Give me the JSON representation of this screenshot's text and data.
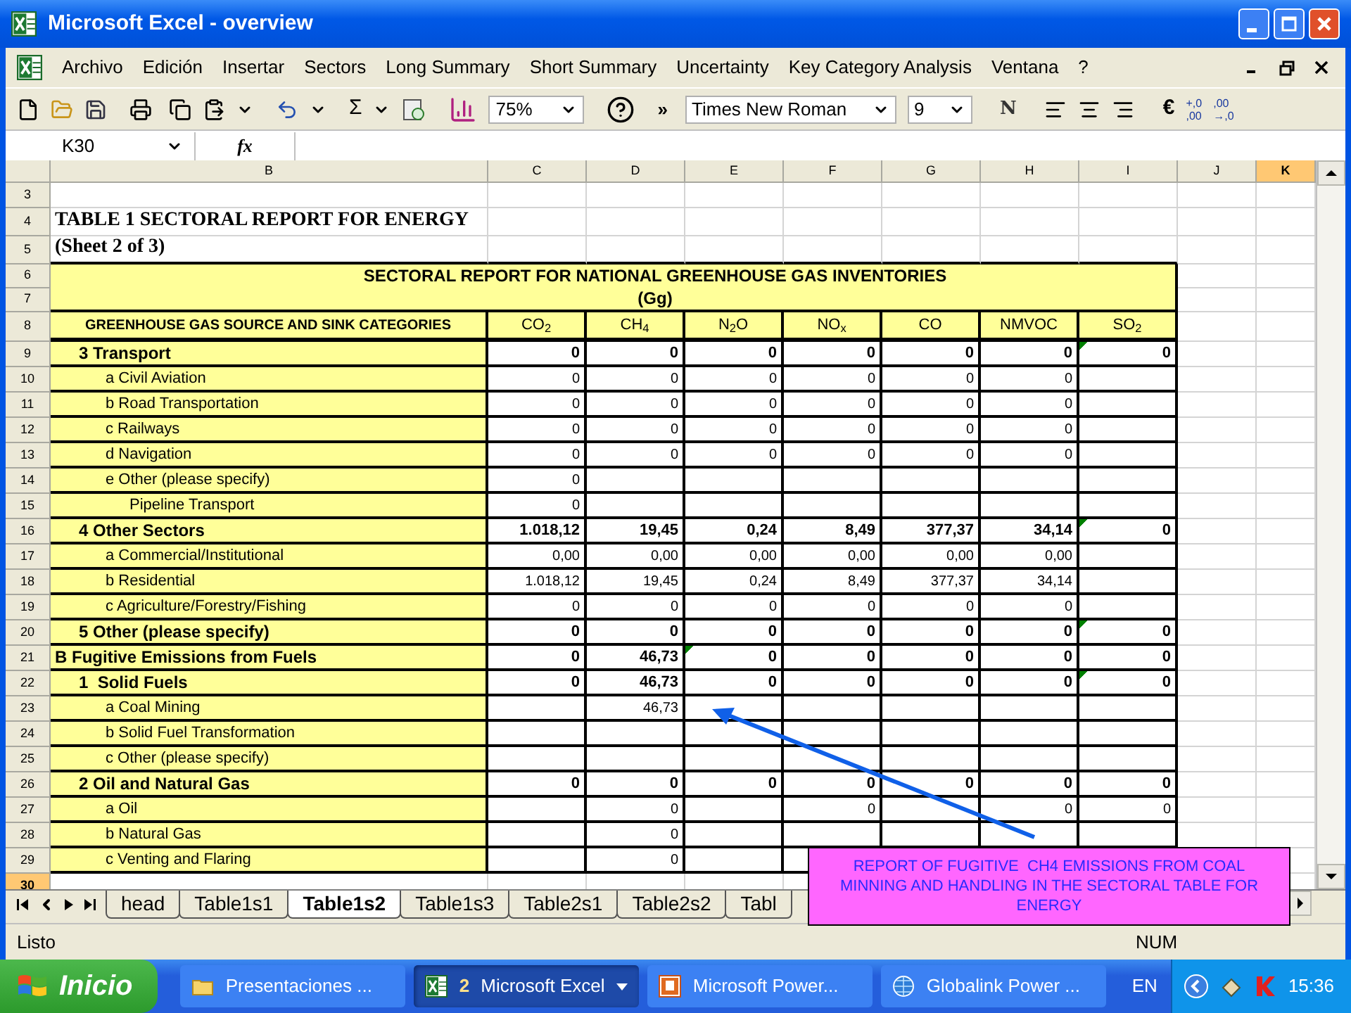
{
  "window": {
    "title": "Microsoft Excel - overview"
  },
  "menu": [
    "Archivo",
    "Edición",
    "Insertar",
    "Sectors",
    "Long Summary",
    "Short Summary",
    "Uncertainty",
    "Key Category Analysis",
    "Ventana",
    "?"
  ],
  "toolbar": {
    "sum": "Σ",
    "more": "»",
    "zoom": "75%",
    "font": "Times New Roman",
    "size": "9",
    "bold": "N",
    "euro": "€",
    "increase_decimal": {
      "top": "+,0",
      "bottom": ",00"
    },
    "decrease_decimal": {
      "top": ",00",
      "bottom": "→,0"
    }
  },
  "formula_bar": {
    "name_box": "K30",
    "fx": "fx"
  },
  "sheet": {
    "columns": [
      {
        "label": "B",
        "selected": false
      },
      {
        "label": "C",
        "selected": false
      },
      {
        "label": "D",
        "selected": false
      },
      {
        "label": "E",
        "selected": false
      },
      {
        "label": "F",
        "selected": false
      },
      {
        "label": "G",
        "selected": false
      },
      {
        "label": "H",
        "selected": false
      },
      {
        "label": "I",
        "selected": false
      },
      {
        "label": "J",
        "selected": false
      },
      {
        "label": "K",
        "selected": true
      }
    ],
    "row_headers": [
      {
        "label": "3",
        "selected": false
      },
      {
        "label": "4",
        "selected": false
      },
      {
        "label": "5",
        "selected": false
      },
      {
        "label": "6",
        "selected": false
      },
      {
        "label": "7",
        "selected": false
      },
      {
        "label": "8",
        "selected": false
      },
      {
        "label": "9",
        "selected": false
      },
      {
        "label": "10",
        "selected": false
      },
      {
        "label": "11",
        "selected": false
      },
      {
        "label": "12",
        "selected": false
      },
      {
        "label": "13",
        "selected": false
      },
      {
        "label": "14",
        "selected": false
      },
      {
        "label": "15",
        "selected": false
      },
      {
        "label": "16",
        "selected": false
      },
      {
        "label": "17",
        "selected": false
      },
      {
        "label": "18",
        "selected": false
      },
      {
        "label": "19",
        "selected": false
      },
      {
        "label": "20",
        "selected": false
      },
      {
        "label": "21",
        "selected": false
      },
      {
        "label": "22",
        "selected": false
      },
      {
        "label": "23",
        "selected": false
      },
      {
        "label": "24",
        "selected": false
      },
      {
        "label": "25",
        "selected": false
      },
      {
        "label": "26",
        "selected": false
      },
      {
        "label": "27",
        "selected": false
      },
      {
        "label": "28",
        "selected": false
      },
      {
        "label": "29",
        "selected": false
      },
      {
        "label": "30",
        "selected": true
      }
    ],
    "title": "TABLE 1 SECTORAL REPORT FOR ENERGY",
    "subtitle": "(Sheet 2 of 3)",
    "report_title": "SECTORAL REPORT FOR NATIONAL GREENHOUSE GAS INVENTORIES",
    "unit": "(Gg)",
    "category_header": "GREENHOUSE GAS SOURCE AND SINK CATEGORIES",
    "gas_headers": [
      "CO$_{2}$",
      "CH$_{4}$",
      "N$_{2}$O",
      "NO$_{x}$",
      "CO",
      "NMVOC",
      "SO$_{2}$"
    ],
    "rows": [
      {
        "kind": "category",
        "label": "3 Transport",
        "cells": [
          {
            "text": "0",
            "flag": false
          },
          {
            "text": "0",
            "flag": false
          },
          {
            "text": "0",
            "flag": false
          },
          {
            "text": "0",
            "flag": false
          },
          {
            "text": "0",
            "flag": false
          },
          {
            "text": "0",
            "flag": false
          },
          {
            "text": "0",
            "flag": true
          }
        ]
      },
      {
        "kind": "item",
        "label": "a Civil Aviation",
        "cells": [
          {
            "text": "0",
            "flag": false
          },
          {
            "text": "0",
            "flag": false
          },
          {
            "text": "0",
            "flag": false
          },
          {
            "text": "0",
            "flag": false
          },
          {
            "text": "0",
            "flag": false
          },
          {
            "text": "0",
            "flag": false
          },
          {
            "flag": false
          }
        ]
      },
      {
        "kind": "item",
        "label": "b Road Transportation",
        "cells": [
          {
            "text": "0",
            "flag": false
          },
          {
            "text": "0",
            "flag": false
          },
          {
            "text": "0",
            "flag": false
          },
          {
            "text": "0",
            "flag": false
          },
          {
            "text": "0",
            "flag": false
          },
          {
            "text": "0",
            "flag": false
          },
          {
            "flag": false
          }
        ]
      },
      {
        "kind": "item",
        "label": "c Railways",
        "cells": [
          {
            "text": "0",
            "flag": false
          },
          {
            "text": "0",
            "flag": false
          },
          {
            "text": "0",
            "flag": false
          },
          {
            "text": "0",
            "flag": false
          },
          {
            "text": "0",
            "flag": false
          },
          {
            "text": "0",
            "flag": false
          },
          {
            "flag": false
          }
        ]
      },
      {
        "kind": "item",
        "label": "d Navigation",
        "cells": [
          {
            "text": "0",
            "flag": false
          },
          {
            "text": "0",
            "flag": false
          },
          {
            "text": "0",
            "flag": false
          },
          {
            "text": "0",
            "flag": false
          },
          {
            "text": "0",
            "flag": false
          },
          {
            "text": "0",
            "flag": false
          },
          {
            "flag": false
          }
        ]
      },
      {
        "kind": "item",
        "label": "e Other (please specify)",
        "cells": [
          {
            "text": "0",
            "flag": false
          },
          {
            "flag": false
          },
          {
            "flag": false
          },
          {
            "flag": false
          },
          {
            "flag": false
          },
          {
            "flag": false
          },
          {
            "flag": false
          }
        ]
      },
      {
        "kind": "detail",
        "label": "Pipeline Transport",
        "cells": [
          {
            "text": "0",
            "flag": false
          },
          {
            "flag": false
          },
          {
            "flag": false
          },
          {
            "flag": false
          },
          {
            "flag": false
          },
          {
            "flag": false
          },
          {
            "flag": false
          }
        ]
      },
      {
        "kind": "category",
        "label": "4 Other Sectors",
        "cells": [
          {
            "text": "1.018,12",
            "flag": false
          },
          {
            "text": "19,45",
            "flag": false
          },
          {
            "text": "0,24",
            "flag": false
          },
          {
            "text": "8,49",
            "flag": false
          },
          {
            "text": "377,37",
            "flag": false
          },
          {
            "text": "34,14",
            "flag": false
          },
          {
            "text": "0",
            "flag": true
          }
        ]
      },
      {
        "kind": "item",
        "label": "a Commercial/Institutional",
        "cells": [
          {
            "text": "0,00",
            "flag": false
          },
          {
            "text": "0,00",
            "flag": false
          },
          {
            "text": "0,00",
            "flag": false
          },
          {
            "text": "0,00",
            "flag": false
          },
          {
            "text": "0,00",
            "flag": false
          },
          {
            "text": "0,00",
            "flag": false
          },
          {
            "flag": false
          }
        ]
      },
      {
        "kind": "item",
        "label": "b Residential",
        "cells": [
          {
            "text": "1.018,12",
            "flag": false
          },
          {
            "text": "19,45",
            "flag": false
          },
          {
            "text": "0,24",
            "flag": false
          },
          {
            "text": "8,49",
            "flag": false
          },
          {
            "text": "377,37",
            "flag": false
          },
          {
            "text": "34,14",
            "flag": false
          },
          {
            "flag": false
          }
        ]
      },
      {
        "kind": "item",
        "label": "c Agriculture/Forestry/Fishing",
        "cells": [
          {
            "text": "0",
            "flag": false
          },
          {
            "text": "0",
            "flag": false
          },
          {
            "text": "0",
            "flag": false
          },
          {
            "text": "0",
            "flag": false
          },
          {
            "text": "0",
            "flag": false
          },
          {
            "text": "0",
            "flag": false
          },
          {
            "flag": false
          }
        ]
      },
      {
        "kind": "category",
        "label": "5 Other (please specify)",
        "cells": [
          {
            "text": "0",
            "flag": false
          },
          {
            "text": "0",
            "flag": false
          },
          {
            "text": "0",
            "flag": false
          },
          {
            "text": "0",
            "flag": false
          },
          {
            "text": "0",
            "flag": false
          },
          {
            "text": "0",
            "flag": false
          },
          {
            "text": "0",
            "flag": true
          }
        ]
      },
      {
        "kind": "section",
        "label": "B Fugitive Emissions from Fuels",
        "cells": [
          {
            "text": "0",
            "flag": false
          },
          {
            "text": "46,73",
            "flag": false
          },
          {
            "text": "0",
            "flag": true
          },
          {
            "text": "0",
            "flag": false
          },
          {
            "text": "0",
            "flag": false
          },
          {
            "text": "0",
            "flag": false
          },
          {
            "text": "0",
            "flag": false
          }
        ]
      },
      {
        "kind": "category",
        "label": "1  Solid Fuels",
        "cells": [
          {
            "text": "0",
            "flag": false
          },
          {
            "text": "46,73",
            "flag": false
          },
          {
            "text": "0",
            "flag": false
          },
          {
            "text": "0",
            "flag": false
          },
          {
            "text": "0",
            "flag": false
          },
          {
            "text": "0",
            "flag": false
          },
          {
            "text": "0",
            "flag": true
          }
        ]
      },
      {
        "kind": "item",
        "label": "a Coal Mining",
        "cells": [
          {
            "flag": false
          },
          {
            "text": "46,73",
            "flag": false
          },
          {
            "flag": false
          },
          {
            "flag": false
          },
          {
            "flag": false
          },
          {
            "flag": false
          },
          {
            "flag": false
          }
        ]
      },
      {
        "kind": "item",
        "label": "b Solid Fuel Transformation",
        "cells": [
          {
            "flag": false
          },
          {
            "flag": false
          },
          {
            "flag": false
          },
          {
            "flag": false
          },
          {
            "flag": false
          },
          {
            "flag": false
          },
          {
            "flag": false
          }
        ]
      },
      {
        "kind": "item",
        "label": "c Other (please specify)",
        "cells": [
          {
            "flag": false
          },
          {
            "flag": false
          },
          {
            "flag": false
          },
          {
            "flag": false
          },
          {
            "flag": false
          },
          {
            "flag": false
          },
          {
            "flag": false
          }
        ]
      },
      {
        "kind": "category",
        "label": "2 Oil and Natural Gas",
        "cells": [
          {
            "text": "0",
            "flag": false
          },
          {
            "text": "0",
            "flag": false
          },
          {
            "text": "0",
            "flag": false
          },
          {
            "text": "0",
            "flag": false
          },
          {
            "text": "0",
            "flag": false
          },
          {
            "text": "0",
            "flag": false
          },
          {
            "text": "0",
            "flag": false
          }
        ]
      },
      {
        "kind": "item",
        "label": "a Oil",
        "cells": [
          {
            "flag": false
          },
          {
            "text": "0",
            "flag": false
          },
          {
            "flag": false
          },
          {
            "text": "0",
            "flag": false
          },
          {
            "flag": false
          },
          {
            "text": "0",
            "flag": false
          },
          {
            "text": "0",
            "flag": false
          }
        ]
      },
      {
        "kind": "item",
        "label": "b Natural Gas",
        "cells": [
          {
            "flag": false
          },
          {
            "text": "0",
            "flag": false
          },
          {
            "flag": false
          },
          {
            "flag": false
          },
          {
            "flag": false
          },
          {
            "flag": false
          },
          {
            "flag": false
          }
        ]
      },
      {
        "kind": "item",
        "label": "c Venting and Flaring",
        "cells": [
          {
            "flag": false
          },
          {
            "text": "0",
            "flag": false
          },
          {
            "flag": false
          },
          {
            "flag": false
          }
        ]
      }
    ]
  },
  "sheet_tabs": [
    {
      "label": "head",
      "selected": false
    },
    {
      "label": "Table1s1",
      "selected": false
    },
    {
      "label": "Table1s2",
      "selected": true
    },
    {
      "label": "Table1s3",
      "selected": false
    },
    {
      "label": "Table2s1",
      "selected": false
    },
    {
      "label": "Table2s2",
      "selected": false
    },
    {
      "label": "Tabl",
      "selected": false
    }
  ],
  "callout": {
    "text": "REPORT OF FUGITIVE  CH4 EMISSIONS FROM COAL MINNING AND HANDLING IN THE SECTORAL TABLE FOR ENERGY"
  },
  "status_bar": {
    "status": "Listo",
    "num": "NUM"
  },
  "taskbar": {
    "start": "Inicio",
    "items": [
      {
        "kind": "folder",
        "label": "Presentaciones ...",
        "selected": false
      },
      {
        "kind": "excel",
        "count": "2",
        "label": "Microsoft Excel",
        "selected": true
      },
      {
        "kind": "powerpoint",
        "label": "Microsoft Power...",
        "selected": false
      },
      {
        "kind": "globe",
        "label": "Globalink Power ...",
        "selected": false
      }
    ],
    "language": "EN",
    "clock": "15:36"
  }
}
